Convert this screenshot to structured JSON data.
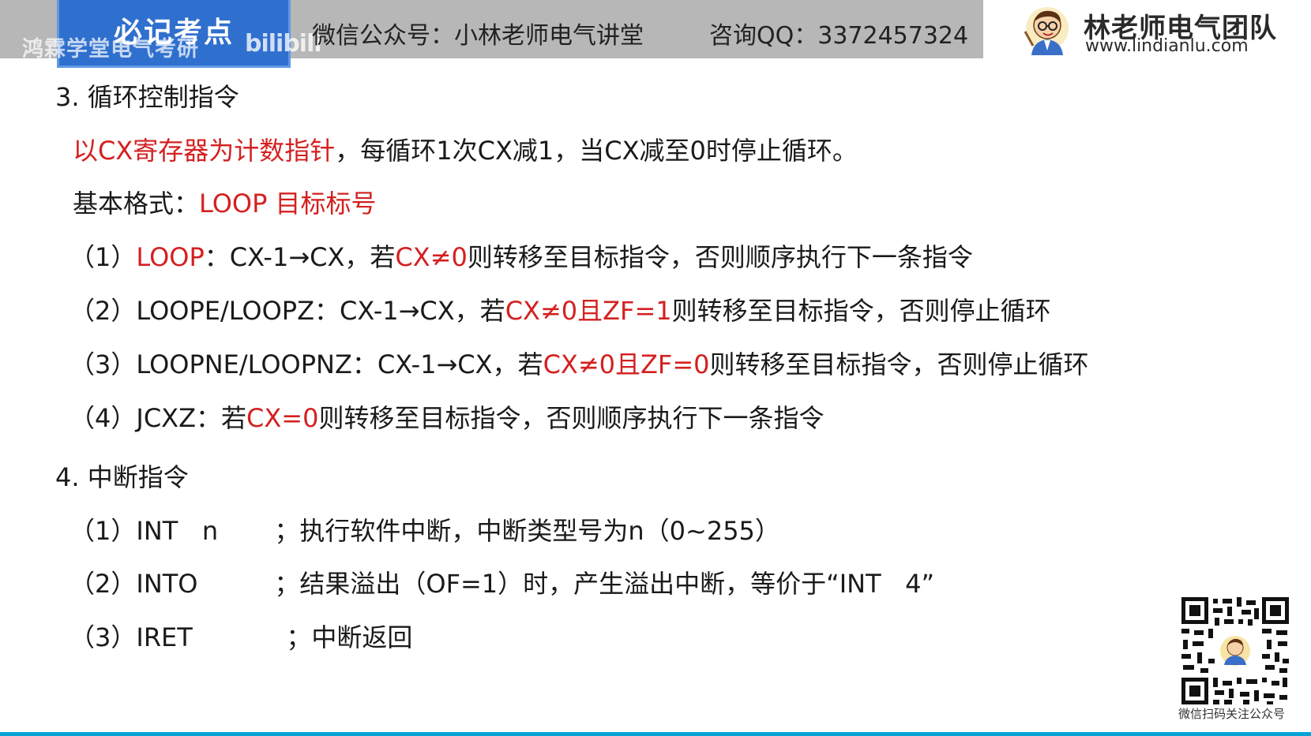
{
  "header": {
    "badge": "必记考点",
    "watermark": "鸿霖学堂电气考研",
    "watermark_logo": "bilibili",
    "wechat": "微信公众号：小林老师电气讲堂",
    "qq": "咨询QQ：3372457324",
    "brand_name": "林老师电气团队",
    "brand_url": "www.lindianlu.com"
  },
  "section3": {
    "heading": "3. 循环控制指令",
    "intro_red": "以CX寄存器为计数指针",
    "intro_rest": "，每循环1次CX减1，当CX减至0时停止循环。",
    "format_label": "基本格式：",
    "format_red": "LOOP  目标标号",
    "items": [
      {
        "num": "（1）",
        "a": "",
        "a_red": "LOOP",
        "b": "：CX-1→CX，若",
        "c_red": "CX≠0",
        "d": "则转移至目标指令，否则顺序执行下一条指令"
      },
      {
        "num": "（2）",
        "a": "LOOPE/LOOPZ",
        "a_red": "",
        "b": "：CX-1→CX，若",
        "c_red": "CX≠0且ZF=1",
        "d": "则转移至目标指令，否则停止循环"
      },
      {
        "num": "（3）",
        "a": "LOOPNE/LOOPNZ",
        "a_red": "",
        "b": "：CX-1→CX，若",
        "c_red": "CX≠0且ZF=0",
        "d": "则转移至目标指令，否则停止循环"
      },
      {
        "num": "（4）",
        "a": "JCXZ",
        "a_red": "",
        "b": "：若",
        "c_red": "CX=0",
        "d": "则转移至目标指令，否则顺序执行下一条指令"
      }
    ]
  },
  "section4": {
    "heading": "4. 中断指令",
    "items": [
      {
        "num": "（1）",
        "instr": "INT   n",
        "desc": "；执行软件中断，中断类型号为n（0~255）"
      },
      {
        "num": "（2）",
        "instr": "INTO",
        "desc": "；结果溢出（OF=1）时，产生溢出中断，等价于“INT   4”"
      },
      {
        "num": "（3）",
        "instr": "IRET",
        "desc": "；中断返回"
      }
    ]
  },
  "qr": {
    "caption": "微信扫码关注公众号"
  },
  "colors": {
    "red": "#d42020",
    "badge_blue": "#2f6fce",
    "header_gray": "#b7b7b7",
    "accent_line": "#0aa3d6"
  }
}
